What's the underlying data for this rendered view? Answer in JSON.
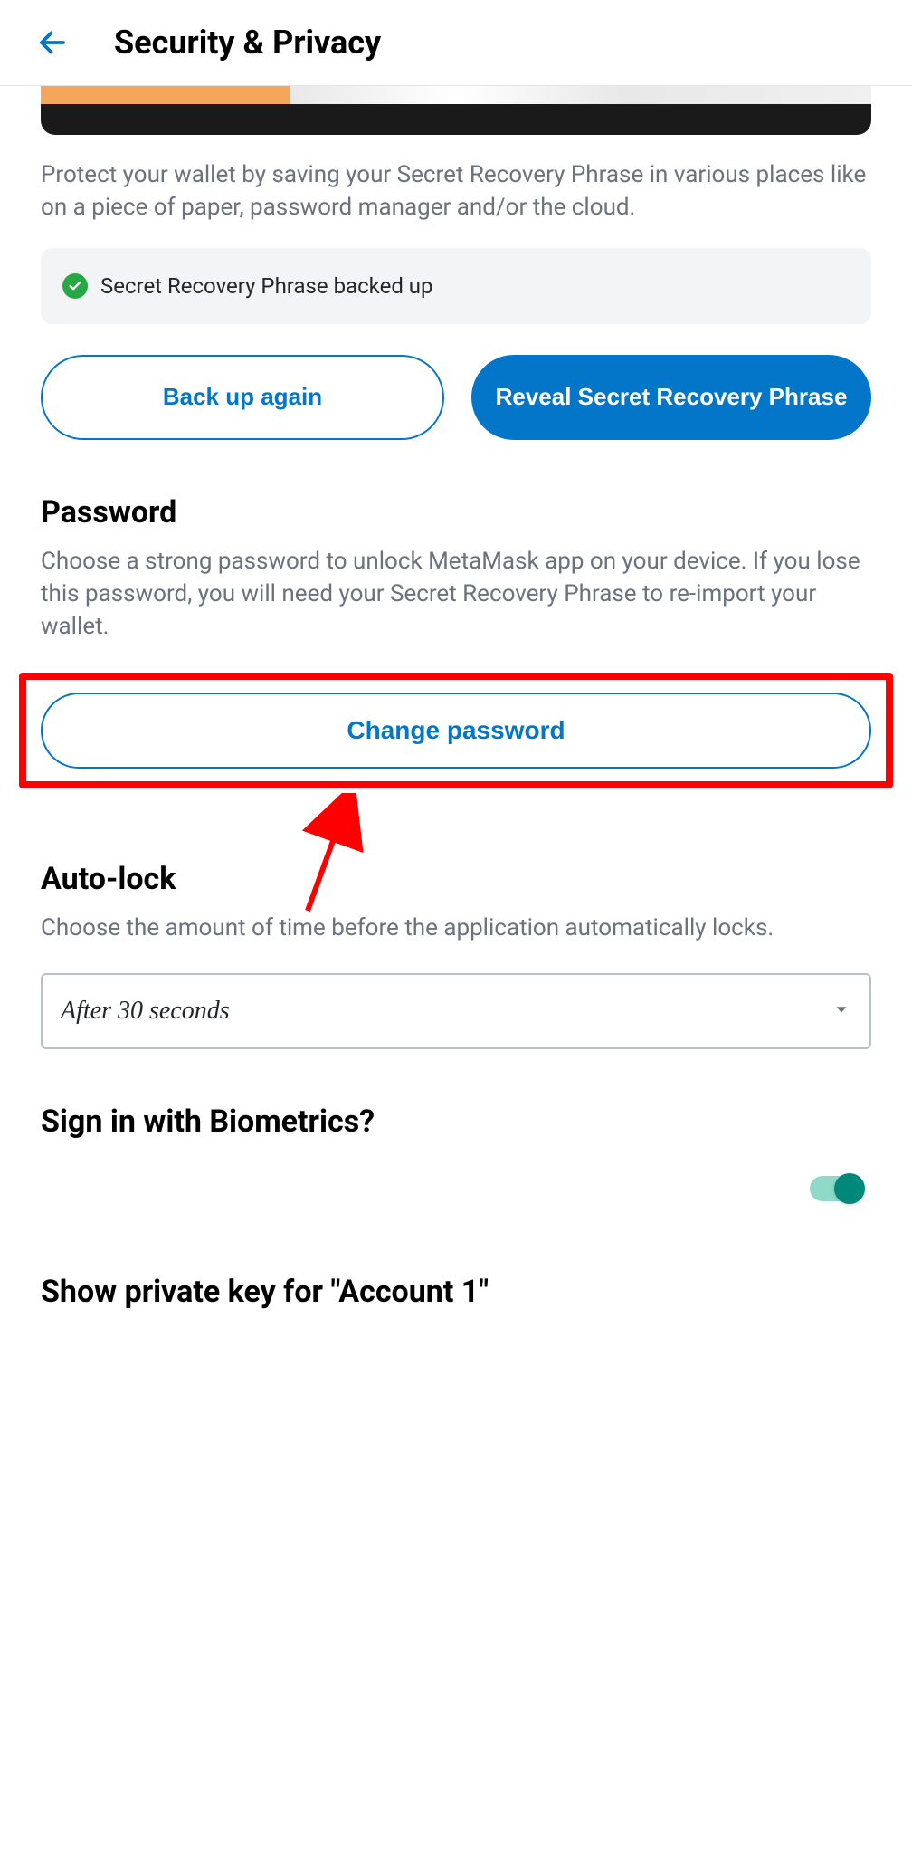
{
  "header": {
    "title": "Security & Privacy"
  },
  "recovery": {
    "description": "Protect your wallet by saving your Secret Recovery Phrase in various places like on a piece of paper, password manager and/or the cloud.",
    "status_text": "Secret Recovery Phrase backed up",
    "backup_button": "Back up again",
    "reveal_button": "Reveal Secret Recovery Phrase"
  },
  "password": {
    "title": "Password",
    "description": "Choose a strong password to unlock MetaMask app on your device. If you lose this password, you will need your Secret Recovery Phrase to re-import your wallet.",
    "button": "Change password"
  },
  "autolock": {
    "title": "Auto-lock",
    "description": "Choose the amount of time before the application automatically locks.",
    "value": "After 30 seconds"
  },
  "biometrics": {
    "title": "Sign in with Biometrics?",
    "enabled": true
  },
  "privatekey": {
    "title": "Show private key for \"Account 1\""
  },
  "colors": {
    "primary": "#0376c9",
    "success": "#28a745",
    "teal": "#00897b",
    "highlight": "#ff0000"
  }
}
